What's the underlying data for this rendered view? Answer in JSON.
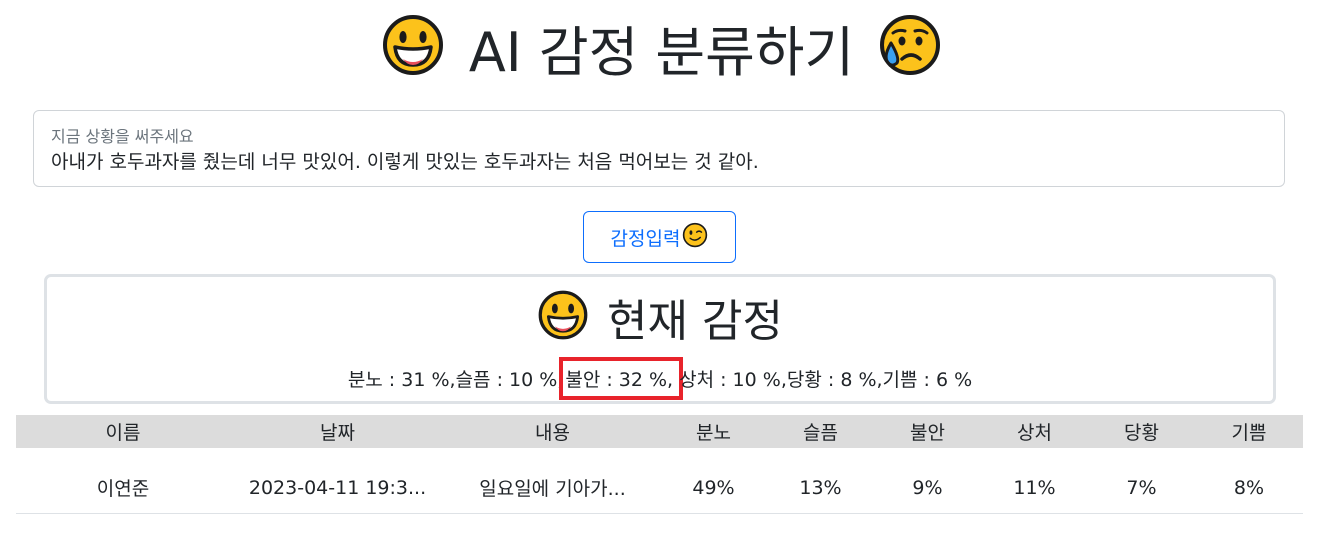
{
  "header": {
    "left_emoji": "grinning-face",
    "title": "AI 감정 분류하기",
    "right_emoji": "sad-sweat-face"
  },
  "input": {
    "label": "지금 상황을 써주세요",
    "value": "아내가 호두과자를 줬는데 너무 맛있어. 이렇게 맛있는 호두과자는 처음 먹어보는 것 같아."
  },
  "submit": {
    "label": "감정입력",
    "emoji": "winking-face"
  },
  "result": {
    "emoji": "grinning-face",
    "title": "현재 감정",
    "scores": [
      "분노 : 31 %, ",
      "슬픔 : 10 %, ",
      "불안 : 32 %, ",
      "상처 : 10 %, ",
      "당황 : 8 %, ",
      "기쁨 : 6 %"
    ],
    "highlight_color": "#e8232b"
  },
  "table": {
    "headers": [
      "이름",
      "날짜",
      "내용",
      "분노",
      "슬픔",
      "불안",
      "상처",
      "당황",
      "기쁨"
    ],
    "rows": [
      [
        "이연준",
        "2023-04-11 19:3...",
        "일요일에 기아가...",
        "49%",
        "13%",
        "9%",
        "11%",
        "7%",
        "8%"
      ]
    ]
  },
  "colors": {
    "accent": "#0d6efd",
    "header_bg": "#dcdcdc"
  }
}
